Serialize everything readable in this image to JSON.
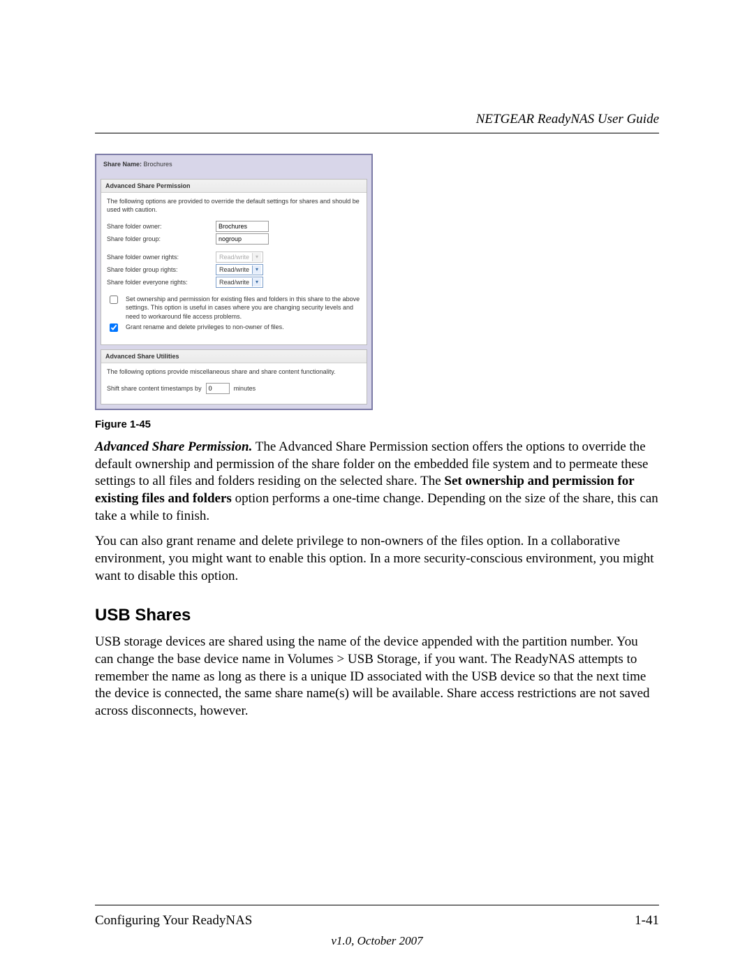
{
  "header": {
    "doc_title": "NETGEAR ReadyNAS User Guide"
  },
  "screenshot": {
    "share_name_label": "Share Name:",
    "share_name_value": "Brochures",
    "panel1": {
      "title": "Advanced Share Permission",
      "intro": "The following options are provided to override the default settings for shares and should be used with caution.",
      "rows": {
        "owner_label": "Share folder owner:",
        "owner_value": "Brochures",
        "group_label": "Share folder group:",
        "group_value": "nogroup",
        "owner_rights_label": "Share folder owner rights:",
        "owner_rights_value": "Read/write",
        "group_rights_label": "Share folder group rights:",
        "group_rights_value": "Read/write",
        "everyone_rights_label": "Share folder everyone rights:",
        "everyone_rights_value": "Read/write"
      },
      "chk1": "Set ownership and permission for existing files and folders in this share to the above settings. This option is useful in cases where you are changing security levels and need to workaround file access problems.",
      "chk2": "Grant rename and delete privileges to non-owner of files."
    },
    "panel2": {
      "title": "Advanced Share Utilities",
      "intro": "The following options provide miscellaneous share and share content functionality.",
      "shift_pre": "Shift share content timestamps by",
      "shift_value": "0",
      "shift_post": "minutes"
    }
  },
  "figure_caption": "Figure 1-45",
  "para1": {
    "lead": "Advanced Share Permission.",
    "text_a": " The Advanced Share Permission section offers the options to override the default ownership and permission of the share folder on the embedded file system and to permeate these settings to all files and folders residing on the selected share. The ",
    "bold": "Set ownership and permission for existing files and folders",
    "text_b": " option performs a one-time change. Depending on the size of the share, this can take a while to finish."
  },
  "para2": "You can also grant rename and delete privilege to non-owners of the files option. In a collaborative environment, you might want to enable this option. In a more security-conscious environment, you might want to disable this option.",
  "section_heading": "USB Shares",
  "para3": "USB storage devices are shared using the name of the device appended with the partition number. You can change the base device name in Volumes > USB Storage, if you want. The ReadyNAS attempts to remember the name as long as there is a unique ID associated with the USB device so that the next time the device is connected, the same share name(s) will be available. Share access restrictions are not saved across disconnects, however.",
  "footer": {
    "left": "Configuring Your ReadyNAS",
    "right": "1-41",
    "version": "v1.0, October 2007"
  }
}
